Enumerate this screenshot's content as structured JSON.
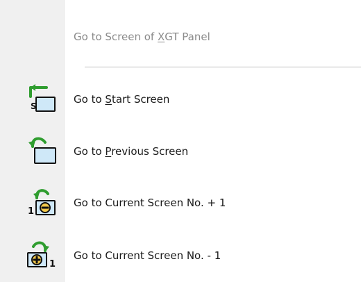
{
  "menu": {
    "header": {
      "before": "Go to Screen of ",
      "mnemonic": "X",
      "after": "GT Panel"
    },
    "items": [
      {
        "before": "Go to ",
        "mnemonic": "S",
        "after": "tart Screen",
        "icon": "start-screen-icon",
        "icon_text": "S"
      },
      {
        "before": "Go to ",
        "mnemonic": "P",
        "after": "revious Screen",
        "icon": "previous-screen-icon"
      },
      {
        "text": "Go to Current Screen No. + 1",
        "icon": "next-screen-number-icon",
        "icon_text": "1"
      },
      {
        "text": "Go to Current Screen No. - 1",
        "icon": "previous-screen-number-icon",
        "icon_text": "1"
      }
    ]
  },
  "colors": {
    "gutter": "#f0f0f0",
    "icon_fill": "#cfe8f8",
    "icon_border": "#111111",
    "arrow_green": "#2f9d2f",
    "badge_yellow": "#f2c94c",
    "text": "#1b1b1b",
    "disabled_text": "#8a8a8a",
    "separator": "#bdbdbd"
  }
}
